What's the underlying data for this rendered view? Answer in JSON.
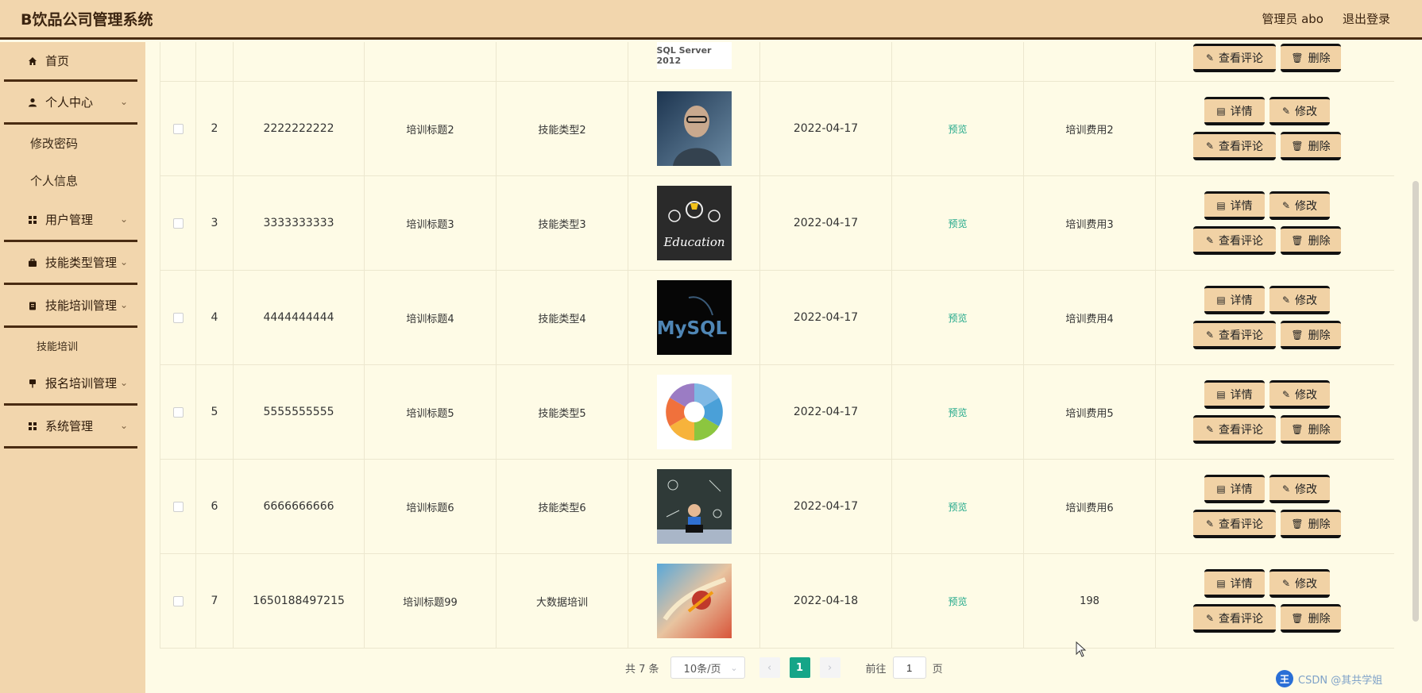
{
  "header": {
    "title": "B饮品公司管理系统",
    "user": "管理员 abo",
    "logout": "退出登录"
  },
  "sidebar": {
    "home": "首页",
    "personal": "个人中心",
    "change_password": "修改密码",
    "personal_info": "个人信息",
    "user_mgmt": "用户管理",
    "skill_type_mgmt": "技能类型管理",
    "skill_training_mgmt": "技能培训管理",
    "skill_training": "技能培训",
    "signup_mgmt": "报名培训管理",
    "system_mgmt": "系统管理"
  },
  "table": {
    "preview_label": "预览",
    "top_image_text": "SQL Server 2012",
    "buttons": {
      "detail": "详情",
      "edit": "修改",
      "comments": "查看评论",
      "delete": "删除"
    },
    "rows": [
      {
        "index": "2",
        "code": "2222222222",
        "title": "培训标题2",
        "type": "技能类型2",
        "image": "programmer-photo",
        "date": "2022-04-17",
        "fee": "培训费用2"
      },
      {
        "index": "3",
        "code": "3333333333",
        "title": "培训标题3",
        "type": "技能类型3",
        "image": "education-chalkboard",
        "image_text": "Education",
        "date": "2022-04-17",
        "fee": "培训费用3"
      },
      {
        "index": "4",
        "code": "4444444444",
        "title": "培训标题4",
        "type": "技能类型4",
        "image": "mysql-logo",
        "image_text": "MySQL",
        "date": "2022-04-17",
        "fee": "培训费用4"
      },
      {
        "index": "5",
        "code": "5555555555",
        "title": "培训标题5",
        "type": "技能类型5",
        "image": "java-wheel-diagram",
        "date": "2022-04-17",
        "fee": "培训费用5"
      },
      {
        "index": "6",
        "code": "6666666666",
        "title": "培训标题6",
        "type": "技能类型6",
        "image": "student-chalkboard",
        "date": "2022-04-17",
        "fee": "培训费用6"
      },
      {
        "index": "7",
        "code": "1650188497215",
        "title": "培训标题99",
        "type": "大数据培训",
        "image": "superhero-art",
        "date": "2022-04-18",
        "fee": "198"
      }
    ]
  },
  "pagination": {
    "total": "共 7 条",
    "page_size": "10条/页",
    "current_page": "1",
    "goto_prefix": "前往",
    "goto_value": "1",
    "goto_suffix": "页"
  },
  "watermark": {
    "icon_text": "王",
    "text": "CSDN @其共学姐"
  },
  "colors": {
    "header_bg": "#f2d6ad",
    "sidebar_bg": "#f2d6ad",
    "content_bg": "#fefbe6",
    "accent": "#15a588",
    "button_bg": "#f1d2a5",
    "border_dark": "#4a2c12"
  }
}
